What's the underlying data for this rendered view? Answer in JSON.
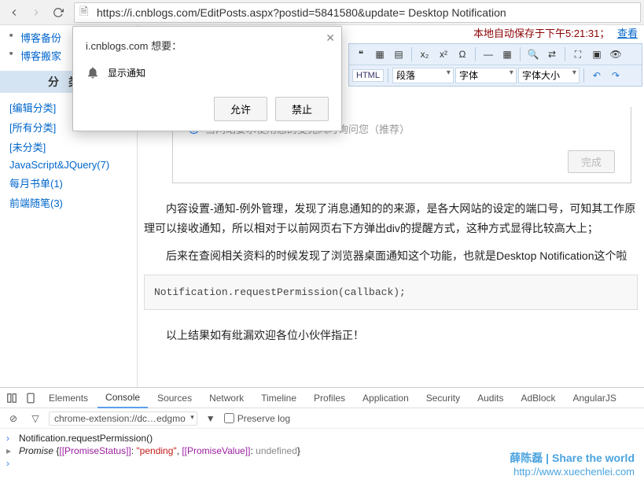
{
  "browser": {
    "url": "https://i.cnblogs.com/EditPosts.aspx?postid=5841580&update= Desktop Notification"
  },
  "permission": {
    "origin": "i.cnblogs.com 想要：",
    "label": "显示通知",
    "allow": "允许",
    "deny": "禁止"
  },
  "sidebar": {
    "top_items": [
      "博客备份",
      "博客搬家"
    ],
    "section": "分类",
    "items": [
      "[编辑分类]",
      "[所有分类]",
      "[未分类]",
      "JavaScript&JQuery(7)",
      "每月书单(1)",
      "前端随笔(3)"
    ]
  },
  "editor": {
    "autosave": "本地自动保存于下午5:21:31；",
    "view": "查看",
    "html_btn": "HTML",
    "format": "段落",
    "font": "字体",
    "fontsize": "字体大小",
    "radio_text": "当网站要求使用您的麦克风时询问您（推荐）",
    "done": "完成"
  },
  "article": {
    "p1": "内容设置-通知-例外管理，发现了消息通知的的来源，是各大网站的设定的端口号，可知其工作原理可以接收通知，所以相对于以前网页右下方弹出div的提醒方式，这种方式显得比较高大上；",
    "p2": "后来在查阅相关资料的时候发现了浏览器桌面通知这个功能，也就是Desktop Notification这个啦",
    "code": "Notification.requestPermission(callback);",
    "p3": "以上结果如有纰漏欢迎各位小伙伴指正！"
  },
  "devtools": {
    "tabs": [
      "Elements",
      "Console",
      "Sources",
      "Network",
      "Timeline",
      "Profiles",
      "Application",
      "Security",
      "Audits",
      "AdBlock",
      "AngularJS"
    ],
    "active_tab": "Console",
    "context": "chrome-extension://dc…edgmo",
    "preserve_log": "Preserve log",
    "line1": "Notification.requestPermission()",
    "promise_label": "Promise",
    "promise_status_k": "[[PromiseStatus]]",
    "promise_status_v": "\"pending\"",
    "promise_value_k": "[[PromiseValue]]",
    "promise_value_v": "undefined"
  },
  "watermark": {
    "title": "薛陈磊 | Share the world",
    "url": "http://www.xuechenlei.com"
  }
}
